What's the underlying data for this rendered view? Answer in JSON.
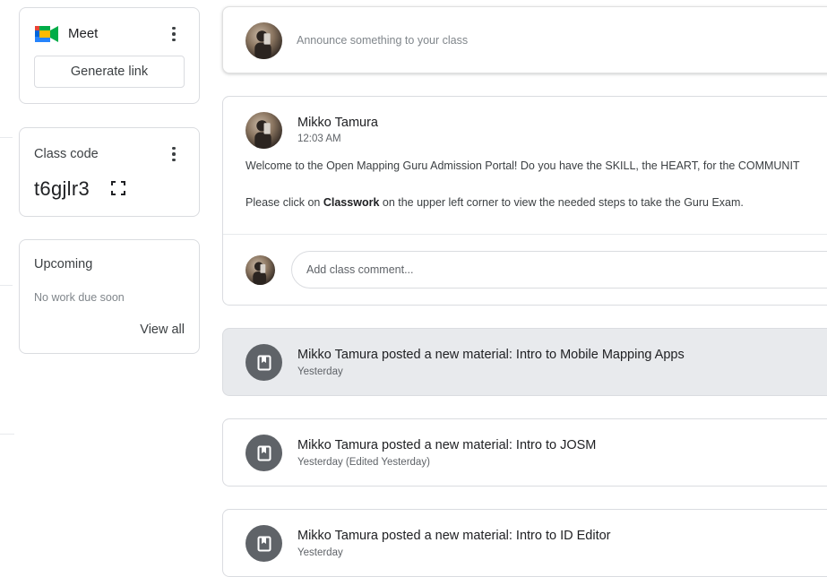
{
  "meet": {
    "title": "Meet",
    "generate_label": "Generate link"
  },
  "class_code": {
    "label": "Class code",
    "value": "t6gjlr3"
  },
  "upcoming": {
    "title": "Upcoming",
    "empty_text": "No work due soon",
    "view_all_label": "View all"
  },
  "announce": {
    "placeholder": "Announce something to your class"
  },
  "post": {
    "author": "Mikko Tamura",
    "time": "12:03 AM",
    "line1": "Welcome to the Open Mapping Guru Admission Portal! Do you have the SKILL, the HEART, for the COMMUNIT",
    "line2_before": "Please click on ",
    "line2_bold": "Classwork",
    "line2_after": " on the upper left corner to view the needed steps to take the Guru Exam.",
    "comment_placeholder": "Add class comment..."
  },
  "materials": [
    {
      "title": "Mikko Tamura posted a new material: Intro to Mobile Mapping Apps",
      "subtitle": "Yesterday"
    },
    {
      "title": "Mikko Tamura posted a new material: Intro to JOSM",
      "subtitle": "Yesterday (Edited Yesterday)"
    },
    {
      "title": "Mikko Tamura posted a new material: Intro to ID Editor",
      "subtitle": "Yesterday"
    }
  ],
  "colors": {
    "material_icon_bg": "#5f6368",
    "highlight_bg": "#e8eaed",
    "border": "#dadce0"
  },
  "icons": {
    "meet": "google-meet-icon",
    "kebab": "more-vert-icon",
    "code": "fullscreen-icon",
    "material": "book-icon"
  }
}
